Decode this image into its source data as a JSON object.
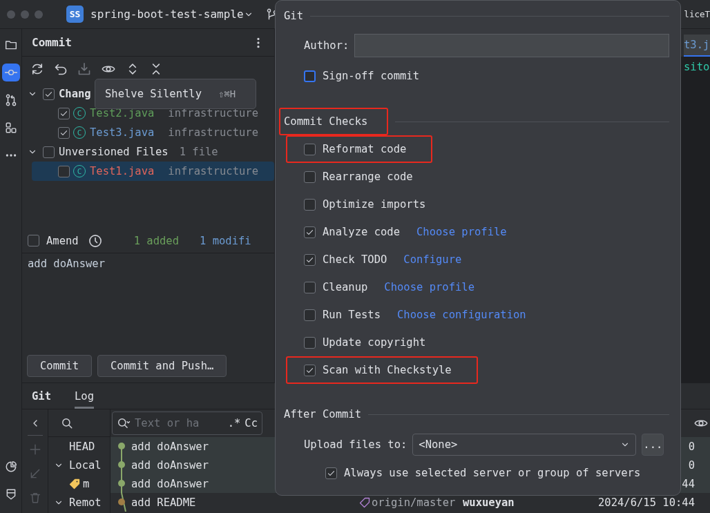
{
  "title_bar": {
    "project_badge": "SS",
    "project": "spring-boot-test-sample",
    "editor_tab_fragment": "liceT"
  },
  "tool_strip": [
    {
      "kind": "folder",
      "selected": false
    },
    {
      "kind": "commit",
      "selected": true
    },
    {
      "kind": "pull-requests",
      "selected": false
    },
    {
      "kind": "structure",
      "selected": false
    },
    {
      "kind": "more",
      "selected": false
    }
  ],
  "tool_strip_bottom": [
    {
      "kind": "pie"
    },
    {
      "kind": "terminal"
    }
  ],
  "commit_panel": {
    "title": "Commit",
    "tree": [
      {
        "label": "Chang",
        "checked": true,
        "expanded": true,
        "children": [
          {
            "badge": "C",
            "name": "Test2.java",
            "path": "infrastructure",
            "checked": true,
            "selected": false,
            "color": "#5f9d5a"
          },
          {
            "badge": "C",
            "name": "Test3.java",
            "path": "infrastructure",
            "checked": true,
            "selected": false,
            "color": "#6b9bd2"
          }
        ]
      },
      {
        "label": "Unversioned Files",
        "count": "1 file",
        "checked": false,
        "expanded": true,
        "children": [
          {
            "badge": "C",
            "name": "Test1.java",
            "path": "infrastructure",
            "checked": false,
            "selected": true,
            "color": "#e0655b"
          }
        ]
      }
    ],
    "amend": {
      "label": "Amend",
      "checked": false
    },
    "summary": [
      {
        "text": "1 added",
        "color": "#6a9f5b"
      },
      {
        "text": "1 modifi",
        "color": "#6b9bd2"
      }
    ],
    "message": "add doAnswer",
    "buttons": [
      "Commit",
      "Commit and Push…"
    ]
  },
  "tooltip": {
    "text": "Shelve Silently",
    "shortcut": "⇧⌘H"
  },
  "editor": {
    "tab": "t3.j",
    "code": "sito"
  },
  "git_window": {
    "tabs": [
      {
        "label": "Git",
        "selected": false
      },
      {
        "label": "Log",
        "selected": true
      }
    ],
    "branches": [
      {
        "label": "HEAD",
        "expanded": false
      },
      {
        "label": "Local",
        "expanded": true,
        "children": [
          {
            "label": "m"
          }
        ]
      },
      {
        "label": "Remot",
        "expanded": true
      }
    ],
    "search": {
      "placeholder": "Text or ha",
      "regex": ".*",
      "match_case": "Cc"
    },
    "commits": [
      {
        "message": "add doAnswer",
        "date": "0",
        "color": "#8aa86a"
      },
      {
        "message": "add doAnswer",
        "date": "0",
        "color": "#8aa86a"
      },
      {
        "message": "add doAnswer",
        "date": "44",
        "color": "#8aa86a"
      },
      {
        "message": "add README",
        "ref": "origin/master",
        "author": "wuxueyan",
        "date": "2024/6/15 10:44",
        "color": "#a07d45"
      }
    ]
  },
  "commit_popup": {
    "git": {
      "heading": "Git",
      "author_label": "Author:",
      "sign_off": {
        "label": "Sign-off commit",
        "checked": false
      }
    },
    "commit_checks": {
      "heading": "Commit Checks",
      "highlighted": true,
      "items": [
        {
          "label": "Reformat code",
          "checked": false,
          "highlighted": true
        },
        {
          "label": "Rearrange code",
          "checked": false,
          "highlighted": false
        },
        {
          "label": "Optimize imports",
          "checked": false,
          "highlighted": false
        },
        {
          "label": "Analyze code",
          "checked": true,
          "highlighted": false,
          "link": "Choose profile"
        },
        {
          "label": "Check TODO",
          "checked": true,
          "highlighted": false,
          "link": "Configure"
        },
        {
          "label": "Cleanup",
          "checked": false,
          "highlighted": false,
          "link": "Choose profile"
        },
        {
          "label": "Run Tests",
          "checked": false,
          "highlighted": false,
          "link": "Choose configuration"
        },
        {
          "label": "Update copyright",
          "checked": false,
          "highlighted": false
        },
        {
          "label": "Scan with Checkstyle",
          "checked": true,
          "highlighted": true
        }
      ]
    },
    "after_commit": {
      "heading": "After Commit",
      "upload_label": "Upload files to:",
      "upload_value": "<None>",
      "browse": "...",
      "always": {
        "label": "Always use selected server or group of servers",
        "checked": true
      }
    }
  }
}
